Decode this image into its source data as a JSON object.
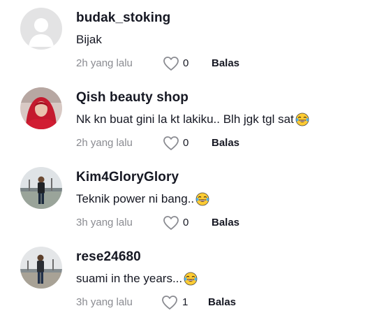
{
  "colors": {
    "username": "#161823",
    "meta": "#8a8b91",
    "default_avatar_bg": "#e3e3e4"
  },
  "comments": [
    {
      "username": "budak_stoking",
      "text": "Bijak",
      "emoji": "",
      "time": "2h yang lalu",
      "likes": "0",
      "reply_label": "Balas"
    },
    {
      "username": "Qish beauty shop",
      "text": "Nk kn buat gini la kt lakiku.. Blh jgk tgl sat",
      "emoji": "tears-of-joy-emoji",
      "time": "2h yang lalu",
      "likes": "0",
      "reply_label": "Balas"
    },
    {
      "username": "Kim4GloryGlory",
      "text": "Teknik power ni bang..",
      "emoji": "tears-of-joy-emoji",
      "time": "3h yang lalu",
      "likes": "0",
      "reply_label": "Balas"
    },
    {
      "username": "rese24680",
      "text": "suami in the years...",
      "emoji": "tears-of-joy-emoji",
      "time": "3h yang lalu",
      "likes": "1",
      "reply_label": "Balas"
    }
  ]
}
